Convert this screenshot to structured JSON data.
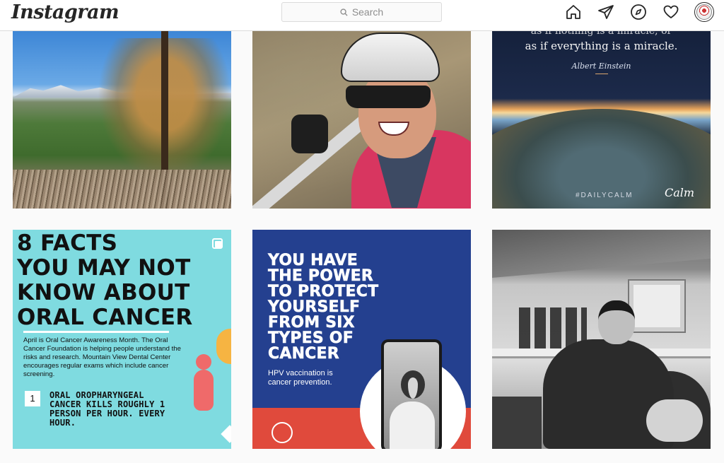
{
  "header": {
    "logo": "Instagram",
    "search_placeholder": "Search",
    "icons": [
      "home-icon",
      "direct-message-icon",
      "explore-icon",
      "activity-heart-icon",
      "profile-avatar"
    ]
  },
  "posts": [
    {
      "kind": "photo",
      "alt": ""
    },
    {
      "kind": "photo",
      "alt": ""
    },
    {
      "kind": "quote",
      "quote_line_1": "as if nothing is a miracle, or",
      "quote_line_2": "as if everything is a miracle.",
      "author": "Albert Einstein",
      "hashtag": "#DAILYCALM",
      "brand": "Calm"
    },
    {
      "kind": "infographic",
      "heading_lines": [
        "8 FACTS",
        "YOU MAY NOT",
        "KNOW ABOUT",
        "ORAL CANCER"
      ],
      "body": "April is Oral Cancer Awareness Month. The Oral Cancer Foundation is helping people understand the risks and research. Mountain View Dental Center encourages regular exams which include cancer screening.",
      "fact_number": "1",
      "fact_text": "ORAL OROPHARYNGEAL CANCER KILLS ROUGHLY 1 PERSON PER HOUR. EVERY HOUR."
    },
    {
      "kind": "poster",
      "heading_lines": [
        "YOU HAVE",
        "THE POWER",
        "TO PROTECT",
        "YOURSELF",
        "FROM SIX",
        "TYPES OF",
        "CANCER"
      ],
      "subtext_lines": [
        "HPV vaccination is",
        "cancer prevention."
      ]
    },
    {
      "kind": "photo",
      "alt": ""
    }
  ],
  "colors": {
    "instagram_text": "#262626",
    "border": "#dbdbdb",
    "oral_cancer_bg": "#7fdbe0",
    "hpv_blue": "#24408f",
    "hpv_red": "#e04a3c"
  }
}
